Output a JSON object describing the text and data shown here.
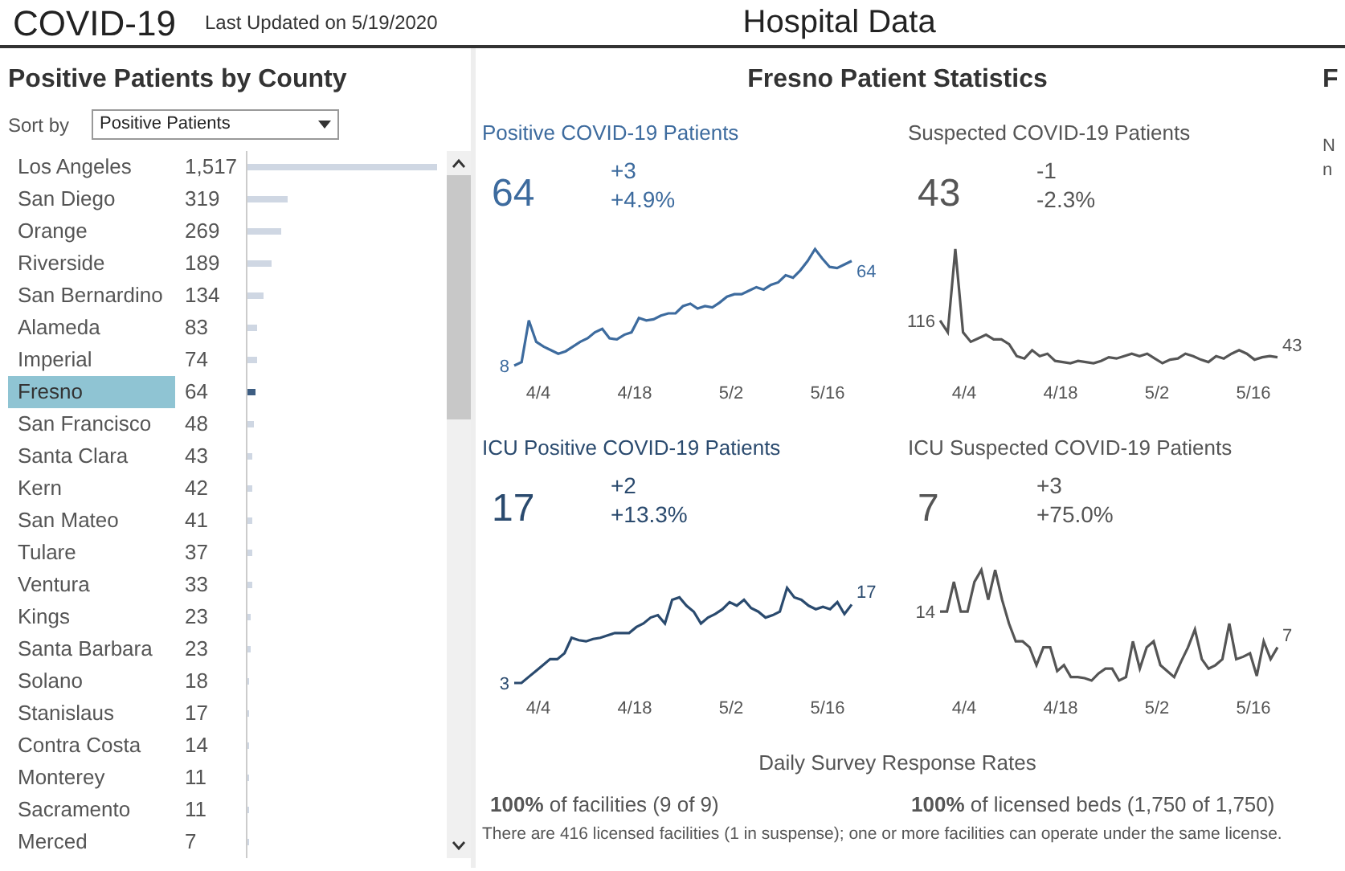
{
  "header": {
    "title": "COVID-19",
    "updated": "Last Updated on 5/19/2020",
    "page_title": "Hospital Data"
  },
  "county_panel": {
    "title": "Positive Patients by County",
    "sort_label": "Sort by",
    "sort_value": "Positive Patients",
    "counties": [
      {
        "name": "Los Angeles",
        "value": "1,517",
        "level": 1.0,
        "selected": false
      },
      {
        "name": "San Diego",
        "value": "319",
        "level": 0.21,
        "selected": false
      },
      {
        "name": "Orange",
        "value": "269",
        "level": 0.177,
        "selected": false
      },
      {
        "name": "Riverside",
        "value": "189",
        "level": 0.125,
        "selected": false
      },
      {
        "name": "San Bernardino",
        "value": "134",
        "level": 0.088,
        "selected": false
      },
      {
        "name": "Alameda",
        "value": "83",
        "level": 0.055,
        "selected": false
      },
      {
        "name": "Imperial",
        "value": "74",
        "level": 0.049,
        "selected": false
      },
      {
        "name": "Fresno",
        "value": "64",
        "level": 0.042,
        "selected": true
      },
      {
        "name": "San Francisco",
        "value": "48",
        "level": 0.032,
        "selected": false
      },
      {
        "name": "Santa Clara",
        "value": "43",
        "level": 0.028,
        "selected": false
      },
      {
        "name": "Kern",
        "value": "42",
        "level": 0.028,
        "selected": false
      },
      {
        "name": "San Mateo",
        "value": "41",
        "level": 0.027,
        "selected": false
      },
      {
        "name": "Tulare",
        "value": "37",
        "level": 0.024,
        "selected": false
      },
      {
        "name": "Ventura",
        "value": "33",
        "level": 0.022,
        "selected": false
      },
      {
        "name": "Kings",
        "value": "23",
        "level": 0.015,
        "selected": false
      },
      {
        "name": "Santa Barbara",
        "value": "23",
        "level": 0.015,
        "selected": false
      },
      {
        "name": "Solano",
        "value": "18",
        "level": 0.012,
        "selected": false
      },
      {
        "name": "Stanislaus",
        "value": "17",
        "level": 0.011,
        "selected": false
      },
      {
        "name": "Contra Costa",
        "value": "14",
        "level": 0.009,
        "selected": false
      },
      {
        "name": "Monterey",
        "value": "11",
        "level": 0.007,
        "selected": false
      },
      {
        "name": "Sacramento",
        "value": "11",
        "level": 0.007,
        "selected": false
      },
      {
        "name": "Merced",
        "value": "7",
        "level": 0.005,
        "selected": false
      }
    ]
  },
  "stats": {
    "title": "Fresno Patient Statistics",
    "panels": [
      {
        "title": "Positive COVID-19 Patients",
        "color": "#3d6b9e",
        "value": "64",
        "change": "+3",
        "change_pct": "+4.9%",
        "start_label": "8",
        "end_label": "64",
        "ticks": [
          "4/4",
          "4/18",
          "5/2",
          "5/16"
        ]
      },
      {
        "title": "Suspected COVID-19 Patients",
        "color": "#555555",
        "value": "43",
        "change": "-1",
        "change_pct": "-2.3%",
        "start_label": "116",
        "end_label": "43",
        "ticks": [
          "4/4",
          "4/18",
          "5/2",
          "5/16"
        ]
      },
      {
        "title": "ICU Positive COVID-19 Patients",
        "color": "#2a4a6e",
        "value": "17",
        "change": "+2",
        "change_pct": "+13.3%",
        "start_label": "3",
        "end_label": "17",
        "ticks": [
          "4/4",
          "4/18",
          "5/2",
          "5/16"
        ]
      },
      {
        "title": "ICU Suspected COVID-19 Patients",
        "color": "#555555",
        "value": "7",
        "change": "+3",
        "change_pct": "+75.0%",
        "start_label": "14",
        "end_label": "7",
        "ticks": [
          "4/4",
          "4/18",
          "5/2",
          "5/16"
        ]
      }
    ],
    "survey": {
      "title": "Daily Survey Response Rates",
      "rates": [
        "**100%** of facilities (9 of 9)",
        "**100%** of licensed beds (1,750 of 1,750)"
      ],
      "note": "There are 416 licensed facilities (1 in suspense); one or more facilities can operate under the same license."
    }
  },
  "clipped_panel": {
    "title": "F",
    "lines": [
      "N",
      "n"
    ]
  }
}
